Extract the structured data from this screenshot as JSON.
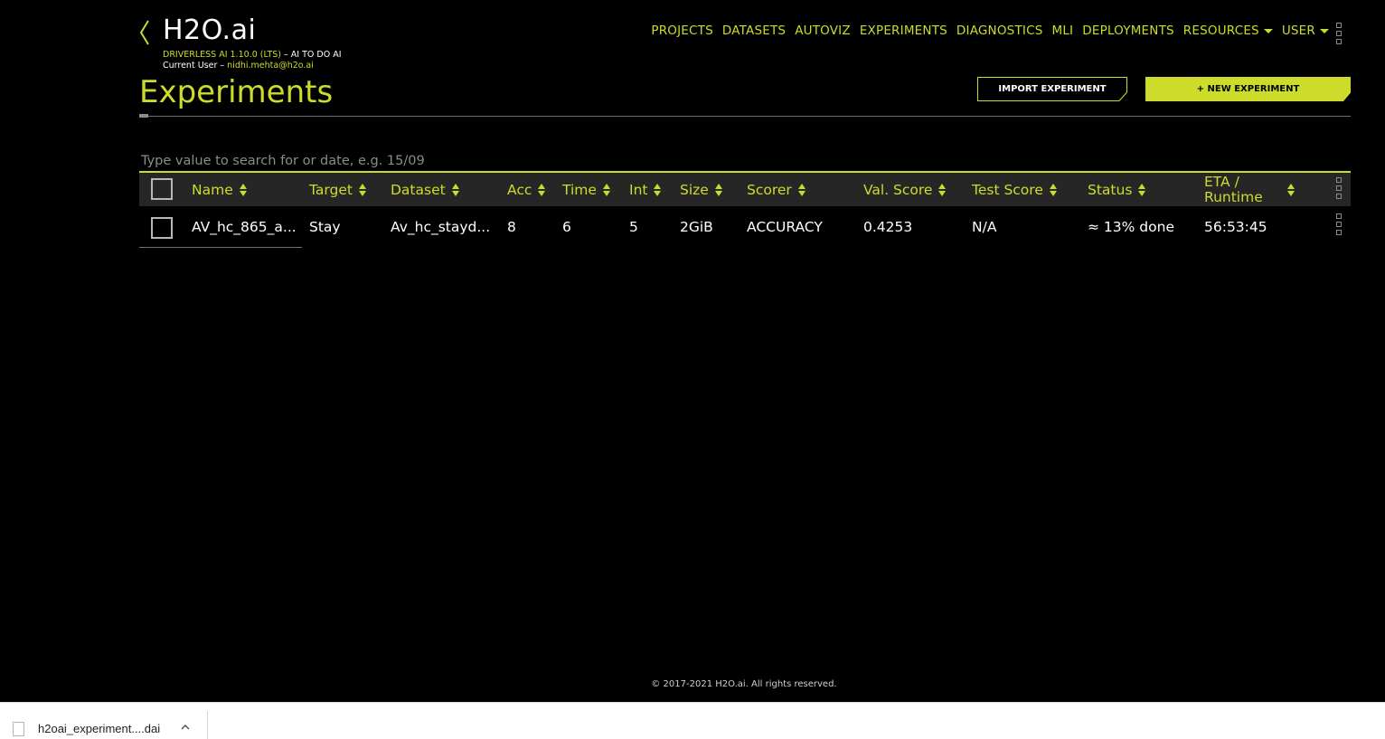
{
  "app": {
    "logo": "H2O.ai",
    "version_label": "DRIVERLESS AI 1.10.0 (LTS)",
    "version_suffix": " – AI TO DO AI",
    "user_prefix": "Current User – ",
    "user_email": "nidhi.mehta@h2o.ai"
  },
  "nav": {
    "items": [
      "PROJECTS",
      "DATASETS",
      "AUTOVIZ",
      "EXPERIMENTS",
      "DIAGNOSTICS",
      "MLI",
      "DEPLOYMENTS"
    ],
    "resources": "RESOURCES",
    "user": "USER"
  },
  "page": {
    "title": "Experiments",
    "import_button": "IMPORT EXPERIMENT",
    "new_button": "+ NEW EXPERIMENT",
    "search_placeholder": "Type value to search for or date, e.g. 15/09"
  },
  "table": {
    "headers": {
      "name": "Name",
      "target": "Target",
      "dataset": "Dataset",
      "acc": "Acc",
      "time": "Time",
      "int": "Int",
      "size": "Size",
      "scorer": "Scorer",
      "val_score": "Val. Score",
      "test_score": "Test Score",
      "status": "Status",
      "eta_line1": "ETA /",
      "eta_line2": "Runtime"
    },
    "rows": [
      {
        "name": "AV_hc_865_a...",
        "target": "Stay",
        "dataset": "Av_hc_stayd...",
        "acc": "8",
        "time": "6",
        "int": "5",
        "size": "2GiB",
        "scorer": "ACCURACY",
        "val_score": "0.4253",
        "test_score": "N/A",
        "status": "≈ 13% done",
        "eta": "56:53:45"
      }
    ]
  },
  "footer": {
    "copyright": "© 2017-2021 H2O.ai. All rights reserved."
  },
  "downloads": {
    "file_name": "h2oai_experiment....dai"
  },
  "colors": {
    "accent": "#cddc2a",
    "background": "#000000",
    "header_row": "#262626"
  }
}
